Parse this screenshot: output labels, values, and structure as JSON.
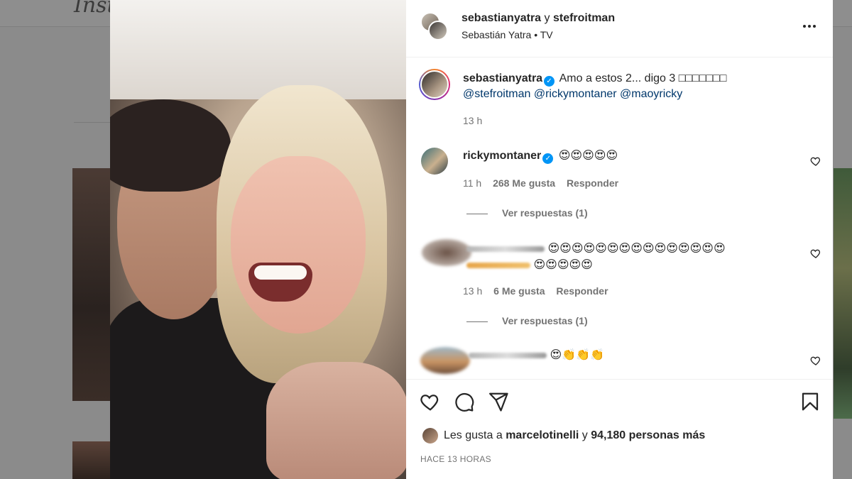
{
  "background": {
    "logo_text": "Insta"
  },
  "post": {
    "header": {
      "author": "sebastianyatra",
      "conjunction": "y",
      "coauthor": "stefroitman",
      "subtitle": "Sebastián Yatra • TV",
      "more_icon": "more-horizontal-icon"
    },
    "caption": {
      "username": "sebastianyatra",
      "verified_icon": "verified-badge-icon",
      "text": "Amo a estos 2... digo 3 □□□□□□□",
      "mentions": [
        "@stefroitman",
        "@rickymontaner",
        "@maoyricky"
      ],
      "time": "13 h"
    },
    "comments": [
      {
        "username": "rickymontaner",
        "verified": true,
        "text": "😍😍😍😍😍",
        "time": "11 h",
        "likes": "268 Me gusta",
        "reply_label": "Responder",
        "view_replies": "Ver respuestas (1)"
      },
      {
        "username": "",
        "verified": false,
        "text_line1": "😍😍😍😍😍😍😍😍😍😍😍😍😍😍😍",
        "text_line2": "😍😍😍😍😍",
        "time": "13 h",
        "likes": "6 Me gusta",
        "reply_label": "Responder",
        "view_replies": "Ver respuestas (1)"
      },
      {
        "username": "",
        "verified": false,
        "text": "😍👏👏👏"
      }
    ],
    "actions": {
      "like_icon": "heart-icon",
      "comment_icon": "comment-icon",
      "share_icon": "send-icon",
      "save_icon": "bookmark-icon"
    },
    "likes": {
      "prefix": "Les gusta a",
      "user": "marcelotinelli",
      "middle": "y",
      "count": "94,180 personas más"
    },
    "posted": "HACE 13 HORAS"
  },
  "colors": {
    "verified": "#0095f6",
    "mention": "#00376b",
    "secondary_text": "#737373"
  }
}
